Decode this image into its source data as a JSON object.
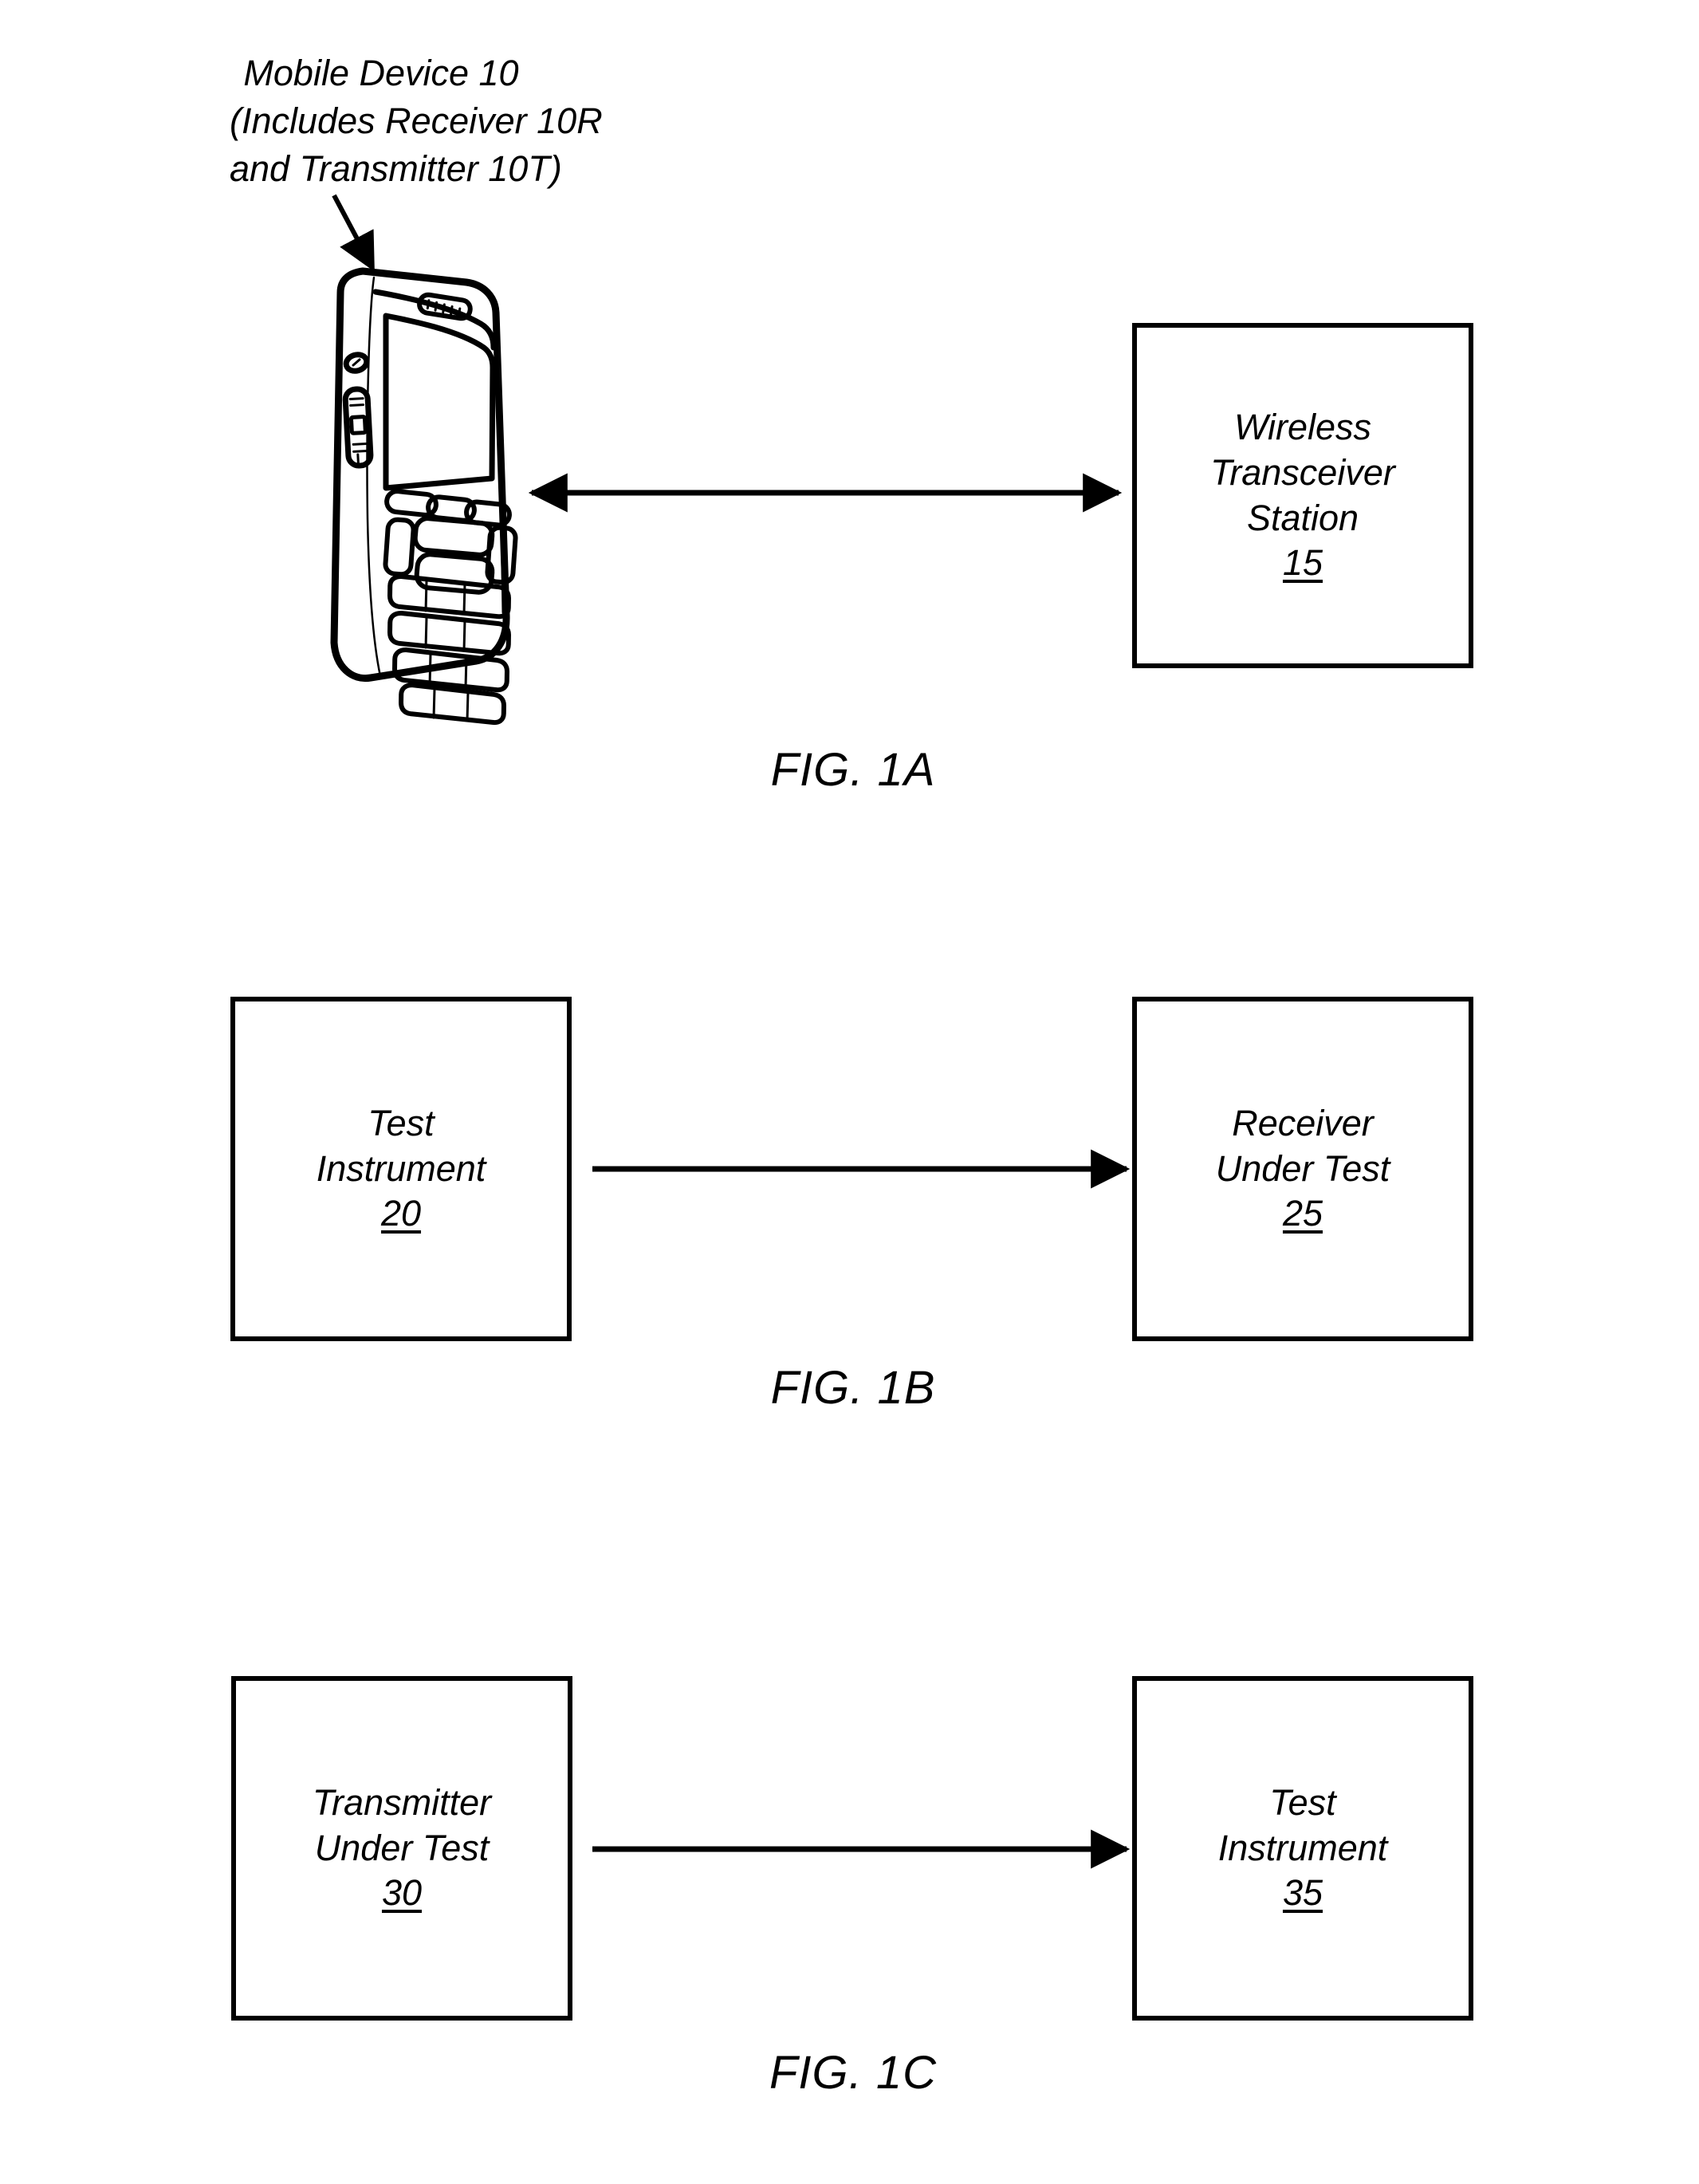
{
  "document": {
    "type": "patent-drawing-sheet",
    "background_color": "#ffffff",
    "ink_color": "#000000"
  },
  "figures": [
    {
      "id": "fig-1a",
      "caption": "FIG. 1A",
      "callout": {
        "lines": [
          "Mobile Device 10",
          "(Includes Receiver 10R",
          "and Transmitter 10T)"
        ],
        "points_to": "mobile-device-illustration"
      },
      "illustration": {
        "name": "mobile-device-illustration",
        "description": "Candybar mobile phone in three-quarter perspective view"
      },
      "blocks": [
        {
          "id": "block-15",
          "lines": [
            "Wireless",
            "Transceiver",
            "Station"
          ],
          "ref": "15"
        }
      ],
      "connector": {
        "type": "double-headed-arrow",
        "from": "mobile-device-illustration",
        "to": "block-15"
      }
    },
    {
      "id": "fig-1b",
      "caption": "FIG. 1B",
      "blocks": [
        {
          "id": "block-20",
          "lines": [
            "Test",
            "Instrument"
          ],
          "ref": "20"
        },
        {
          "id": "block-25",
          "lines": [
            "Receiver",
            "Under Test"
          ],
          "ref": "25"
        }
      ],
      "connector": {
        "type": "single-headed-arrow",
        "from": "block-20",
        "to": "block-25"
      }
    },
    {
      "id": "fig-1c",
      "caption": "FIG. 1C",
      "blocks": [
        {
          "id": "block-30",
          "lines": [
            "Transmitter",
            "Under Test"
          ],
          "ref": "30"
        },
        {
          "id": "block-35",
          "lines": [
            "Test",
            "Instrument"
          ],
          "ref": "35"
        }
      ],
      "connector": {
        "type": "single-headed-arrow",
        "from": "block-30",
        "to": "block-35"
      }
    }
  ],
  "text": {
    "fig_1a_caption": "FIG. 1A",
    "fig_1b_caption": "FIG. 1B",
    "fig_1c_caption": "FIG. 1C",
    "callout_line_1": "Mobile Device 10",
    "callout_line_2": "(Includes Receiver 10R",
    "callout_line_3": "and Transmitter 10T)",
    "block15_line1": "Wireless",
    "block15_line2": "Transceiver",
    "block15_line3": "Station",
    "block15_ref": "15",
    "block20_line1": "Test",
    "block20_line2": "Instrument",
    "block20_ref": "20",
    "block25_line1": "Receiver",
    "block25_line2": "Under Test",
    "block25_ref": "25",
    "block30_line1": "Transmitter",
    "block30_line2": "Under Test",
    "block30_ref": "30",
    "block35_line1": "Test",
    "block35_line2": "Instrument",
    "block35_ref": "35"
  }
}
